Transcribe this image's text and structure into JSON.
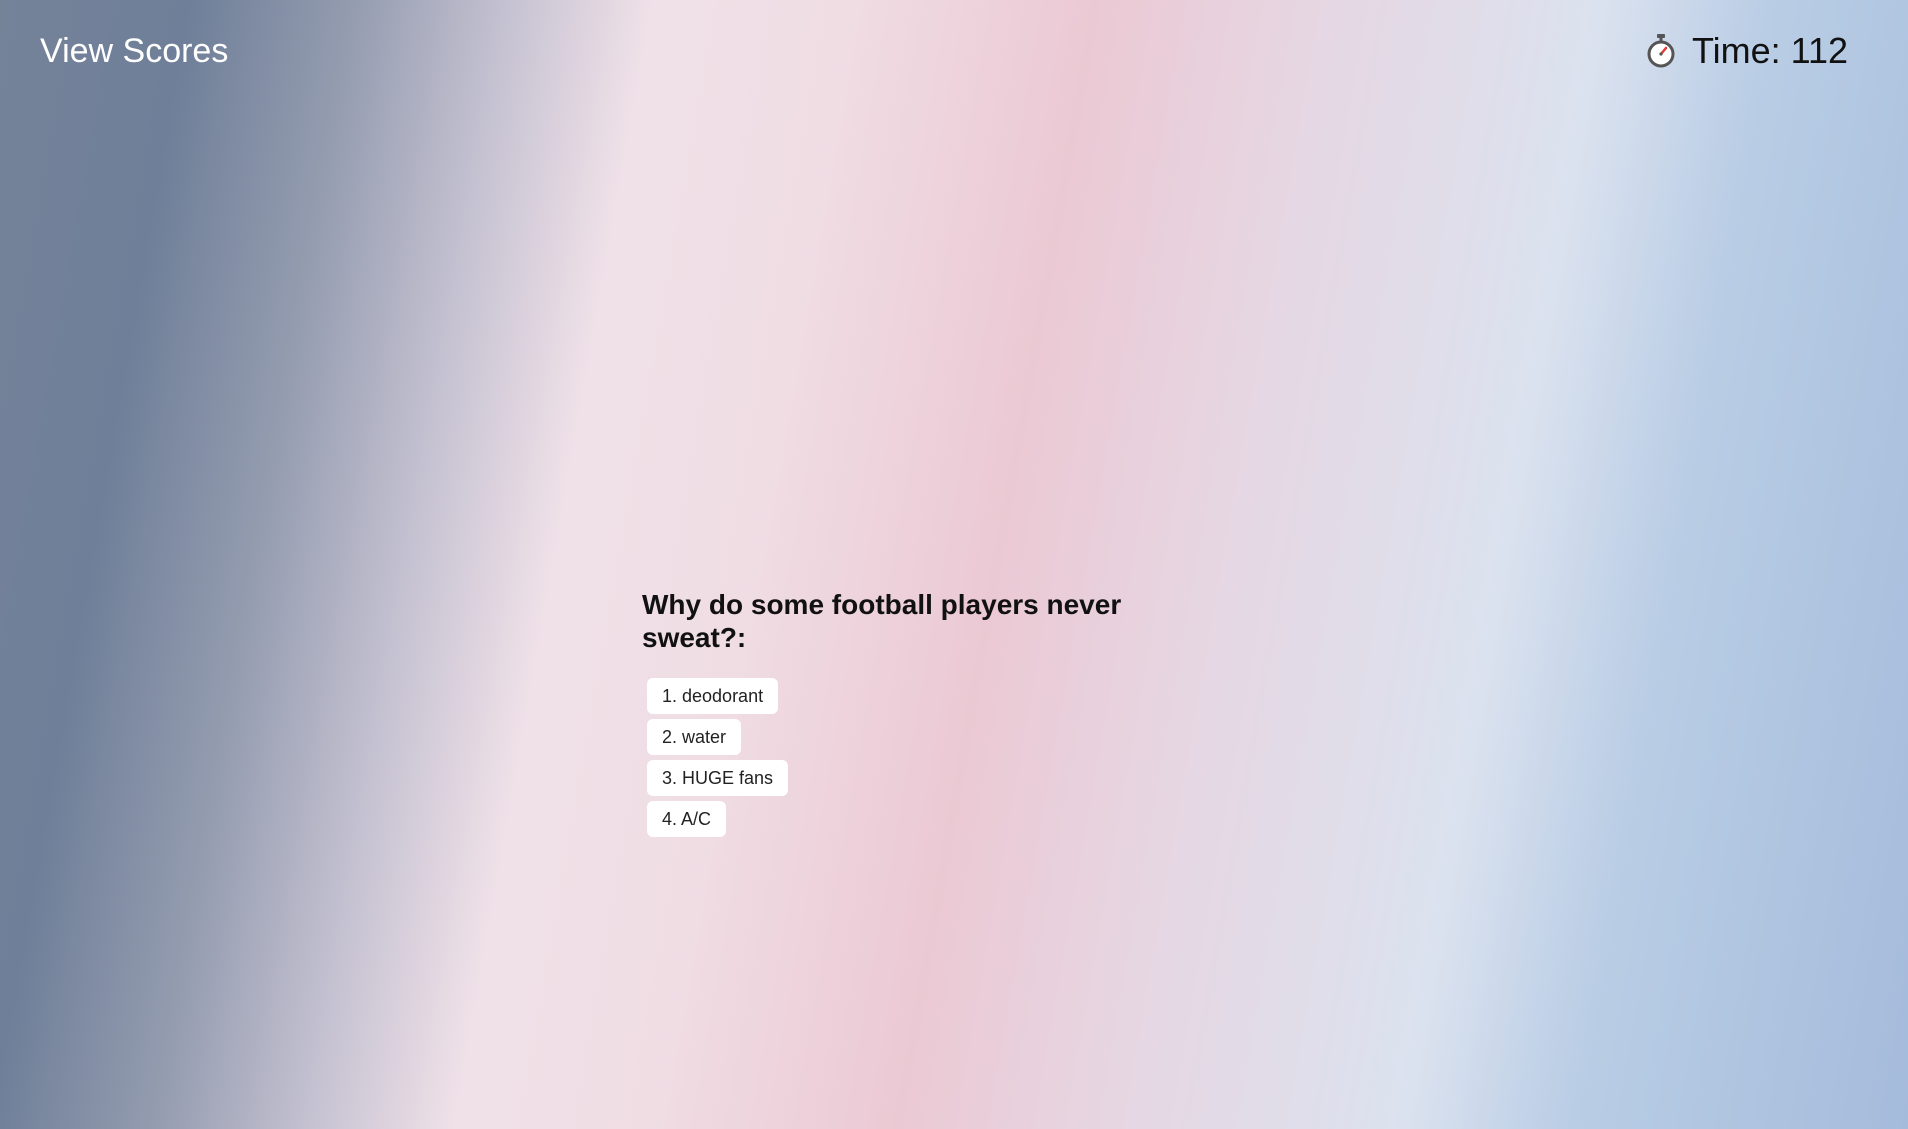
{
  "header": {
    "view_scores_label": "View Scores",
    "timer_icon": "stopwatch-icon",
    "timer_label": "Time: 112"
  },
  "quiz": {
    "question": "Why do some football players never sweat?:",
    "choices": [
      {
        "label": "1. deodorant"
      },
      {
        "label": "2. water"
      },
      {
        "label": "3. HUGE fans"
      },
      {
        "label": "4. A/C"
      }
    ]
  },
  "colors": {
    "timer_hand": "#e53935",
    "button_bg": "#ffffff",
    "header_link": "#ffffff"
  }
}
